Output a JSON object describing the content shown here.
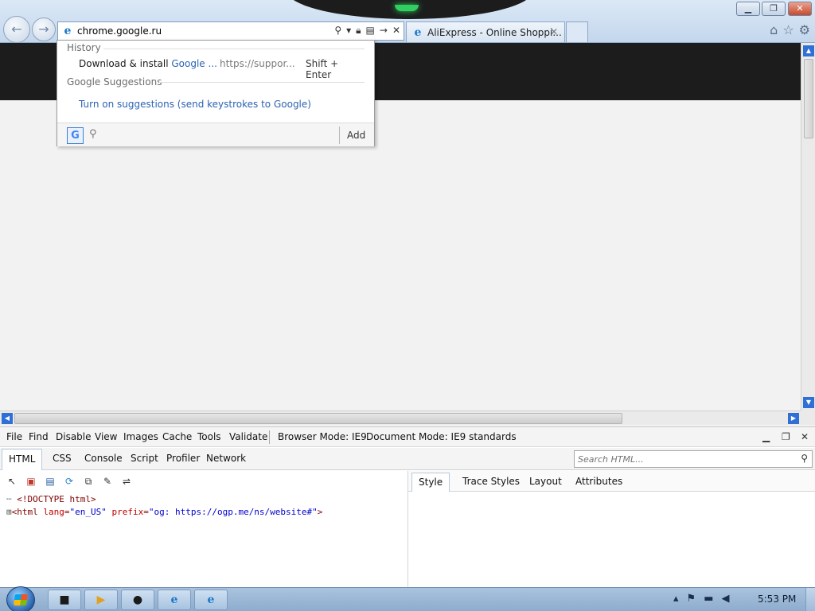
{
  "browser": {
    "address": {
      "value": "chrome.google.ru"
    },
    "tab": {
      "title": "AliExpress - Online Shoppi..."
    }
  },
  "dropdown": {
    "history_heading": "History",
    "history_item": {
      "text_prefix": "Download & install ",
      "text_highlight": "Google ...",
      "url": "https://suppor...",
      "shortcut": "Shift + Enter"
    },
    "suggestions_heading": "Google Suggestions",
    "suggestions_link": "Turn on suggestions (send keystrokes to Google)",
    "add_label": "Add"
  },
  "devtools": {
    "menu": [
      "File",
      "Find",
      "Disable",
      "View",
      "Images",
      "Cache",
      "Tools",
      "Validate"
    ],
    "browser_mode": "Browser Mode: IE9",
    "document_mode": "Document Mode: IE9 standards",
    "tabs": [
      "HTML",
      "CSS",
      "Console",
      "Script",
      "Profiler",
      "Network"
    ],
    "search_placeholder": "Search HTML...",
    "right_tabs": [
      "Style",
      "Trace Styles",
      "Layout",
      "Attributes"
    ],
    "tree": {
      "doctype": "<!DOCTYPE html>",
      "html_open": "<html",
      "attr1_name": "lang",
      "attr1_value": "\"en_US\"",
      "attr2_name": "prefix",
      "attr2_value": "\"og: https://ogp.me/ns/website#\"",
      "html_close": ">"
    }
  },
  "taskbar": {
    "clock": "5:53 PM"
  },
  "colors": {
    "accent": "#2f6fd6",
    "link": "#2c63b3",
    "page_header": "#1c1c1c"
  }
}
